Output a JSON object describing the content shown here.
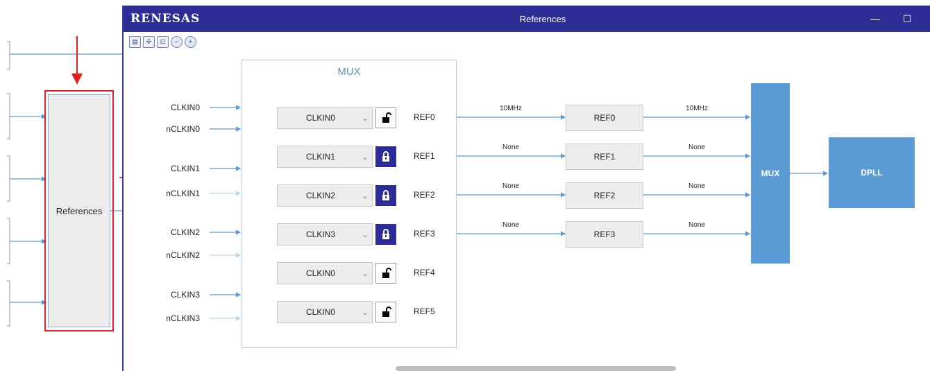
{
  "window": {
    "logo": "RENESAS",
    "title": "References",
    "minimize_glyph": "—",
    "maximize_glyph": "☐"
  },
  "toolbar": {
    "icons": [
      "fit-icon",
      "expand-icon",
      "zoom-100-icon",
      "zoom-out-icon",
      "zoom-in-icon"
    ]
  },
  "background": {
    "references_label": "References"
  },
  "mux_panel": {
    "title": "MUX"
  },
  "inputs": [
    "CLKIN0",
    "nCLKIN0",
    "CLKIN1",
    "nCLKIN1",
    "CLKIN2",
    "nCLKIN2",
    "CLKIN3",
    "nCLKIN3"
  ],
  "selectors": [
    {
      "value": "CLKIN0",
      "locked": false,
      "output": "REF0",
      "freq_in": "10MHz",
      "ref_box": "REF0",
      "freq_out": "10MHz"
    },
    {
      "value": "CLKIN1",
      "locked": true,
      "output": "REF1",
      "freq_in": "None",
      "ref_box": "REF1",
      "freq_out": "None"
    },
    {
      "value": "CLKIN2",
      "locked": true,
      "output": "REF2",
      "freq_in": "None",
      "ref_box": "REF2",
      "freq_out": "None"
    },
    {
      "value": "CLKIN3",
      "locked": true,
      "output": "REF3",
      "freq_in": "None",
      "ref_box": "REF3",
      "freq_out": "None"
    },
    {
      "value": "CLKIN0",
      "locked": false,
      "output": "REF4"
    },
    {
      "value": "CLKIN0",
      "locked": false,
      "output": "REF5"
    }
  ],
  "right_blocks": {
    "mux_label": "MUX",
    "dpll_label": "DPLL"
  },
  "colors": {
    "titlebar": "#2d2d96",
    "block_blue": "#5b9bd5",
    "arrow_blue": "#5b9bd5",
    "annotation_red": "#e02020",
    "lock_active": "#2b2b9a"
  }
}
